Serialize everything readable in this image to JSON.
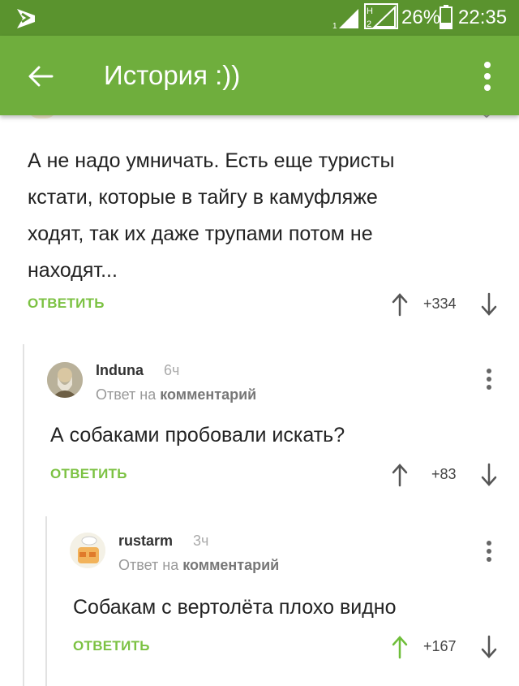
{
  "status_bar": {
    "battery": "26%",
    "time": "22:35"
  },
  "app_bar": {
    "title": "История :))"
  },
  "comments": [
    {
      "text_lines": [
        "А не надо умничать. Есть еще туристы",
        "кстати, которые в тайгу в камуфляже",
        "ходят, так их даже трупами потом не",
        "находят..."
      ],
      "reply_label": "ОТВЕТИТЬ",
      "score": "+334"
    },
    {
      "username": "Induna",
      "time": "6ч",
      "reply_to_prefix": "Ответ на",
      "reply_to_link": "комментарий",
      "text": "А собаками пробовали искать?",
      "reply_label": "ОТВЕТИТЬ",
      "score": "+83"
    },
    {
      "username": "rustarm",
      "time": "3ч",
      "reply_to_prefix": "Ответ на",
      "reply_to_link": "комментарий",
      "text": "Собакам с вертолёта плохо видно",
      "reply_label": "ОТВЕТИТЬ",
      "score": "+167",
      "upvoted": true
    }
  ],
  "colors": {
    "status_bar": "#5a932e",
    "app_bar": "#6fae3d",
    "accent": "#7cc243",
    "upvote_active": "#6fbe3a"
  },
  "icons": {
    "app": "pikabu-notification-icon",
    "back": "arrow-left-icon",
    "menu": "more-vert-icon",
    "up": "arrow-up-icon",
    "down": "arrow-down-icon"
  }
}
